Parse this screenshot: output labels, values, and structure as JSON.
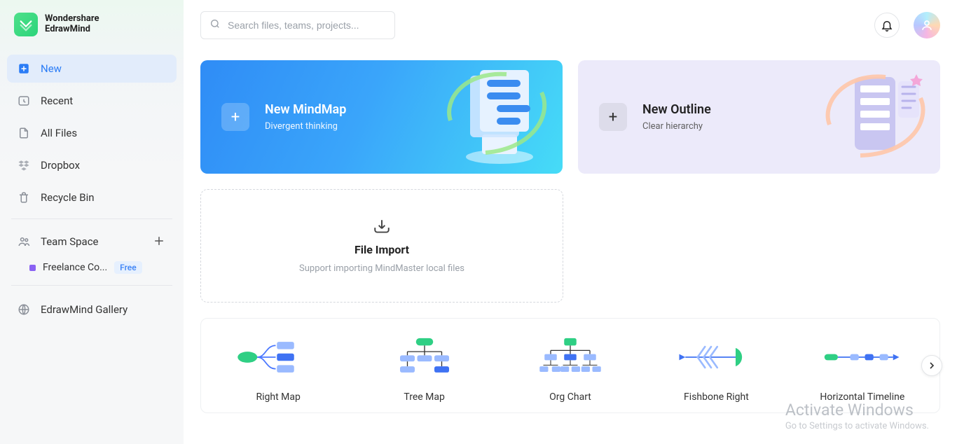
{
  "brand": {
    "line1": "Wondershare",
    "line2": "EdrawMind"
  },
  "search": {
    "placeholder": "Search files, teams, projects..."
  },
  "sidebar": {
    "items": [
      {
        "label": "New"
      },
      {
        "label": "Recent"
      },
      {
        "label": "All Files"
      },
      {
        "label": "Dropbox"
      },
      {
        "label": "Recycle Bin"
      }
    ],
    "teamspace_label": "Team Space",
    "team_item_label": "Freelance Co...",
    "team_badge": "Free",
    "gallery_label": "EdrawMind Gallery"
  },
  "hero": {
    "mindmap_title": "New MindMap",
    "mindmap_sub": "Divergent thinking",
    "outline_title": "New Outline",
    "outline_sub": "Clear hierarchy"
  },
  "import": {
    "title": "File Import",
    "sub": "Support importing MindMaster local files"
  },
  "templates": [
    {
      "label": "Right Map"
    },
    {
      "label": "Tree Map"
    },
    {
      "label": "Org Chart"
    },
    {
      "label": "Fishbone Right"
    },
    {
      "label": "Horizontal Timeline"
    }
  ],
  "watermark": {
    "line1": "Activate Windows",
    "line2": "Go to Settings to activate Windows."
  }
}
